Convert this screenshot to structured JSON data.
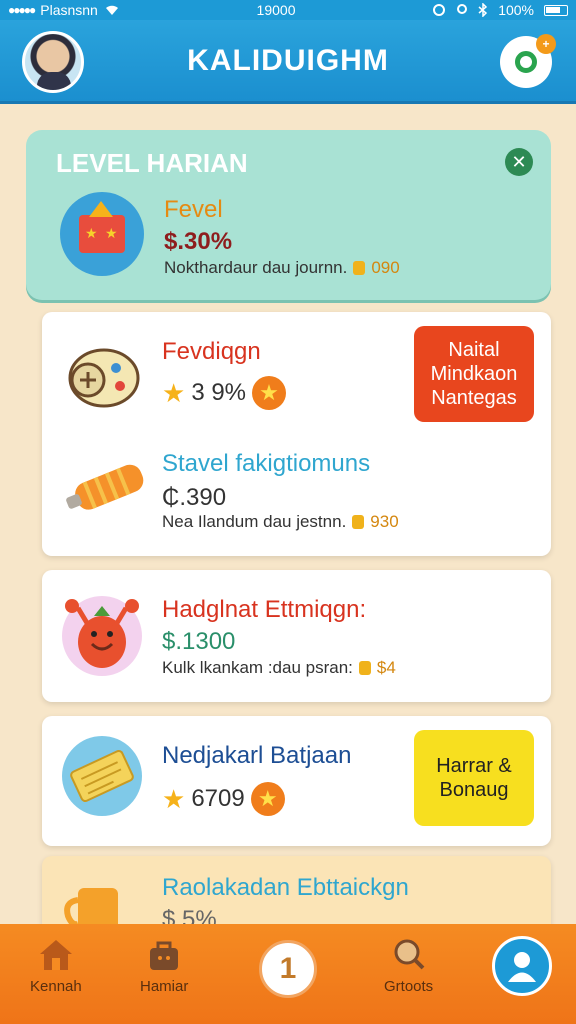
{
  "status_bar": {
    "carrier": "Plasnsnn",
    "time": "19000",
    "battery": "100%"
  },
  "header": {
    "title": "KALIDUIGHM"
  },
  "level_card": {
    "title": "LEVEL HARIAN",
    "item_name": "Fevel",
    "item_value": "$.30%",
    "item_desc": "Nokthardaur dau journn.",
    "item_desc_num": "090"
  },
  "card1": {
    "item1_name": "Fevdiqgn",
    "item1_rating": "3 9%",
    "cta_label": "Naital Mindkaon Nantegas",
    "item2_name": "Stavel fakigtiomuns",
    "item2_value": "₵.390",
    "item2_desc": "Nea Ilandum dau jestnn.",
    "item2_desc_num": "930"
  },
  "card2": {
    "item_name": "Hadglnat Ettmiqgn:",
    "item_value": "$.1300",
    "item_desc": "Kulk lkankam :dau psran:",
    "item_desc_num": "$4"
  },
  "card3": {
    "item_name": "Nedjakarl Batjaan",
    "item_rating": "6709",
    "cta_label": "Harrar & Bonaug"
  },
  "card4": {
    "item_name": "Raolakadan Ebttaickgn",
    "item_value": "$.5%"
  },
  "bottom_nav": {
    "home_label": "Kennah",
    "shop_label": "Hamiar",
    "center_label": "1",
    "settings_label": "Grtoots"
  },
  "colors": {
    "header": "#1d9ad6",
    "level_card": "#a9e2d4",
    "red_cta": "#e8461e",
    "yellow_cta": "#f7df1f",
    "bottom_nav": "#f58b22"
  }
}
